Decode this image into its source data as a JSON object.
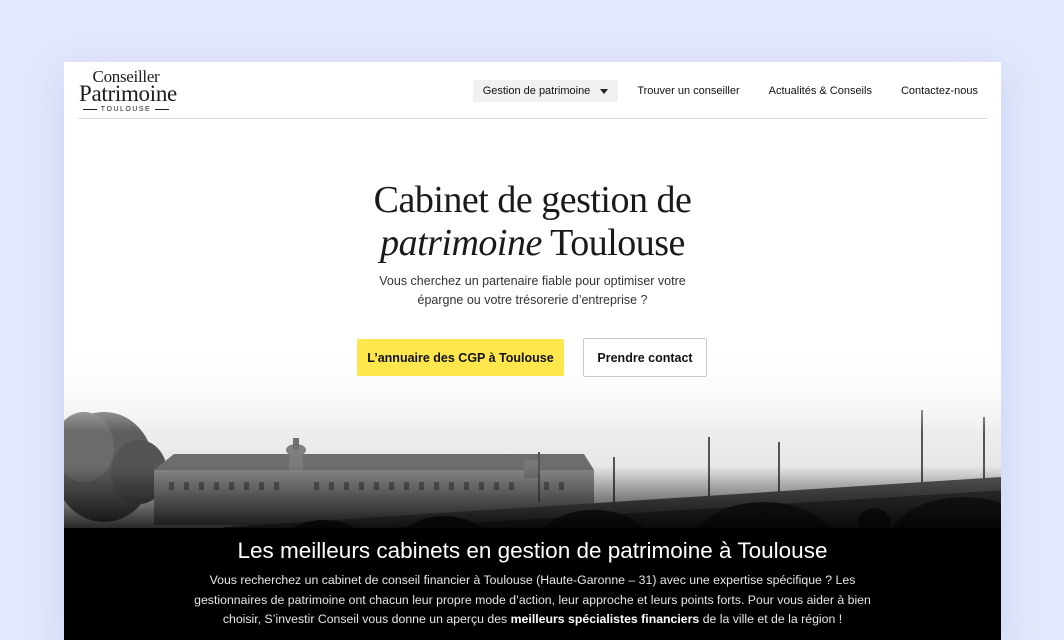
{
  "logo": {
    "line1": "Conseiller",
    "line2": "Patrimoine",
    "line3": "TOULOUSE"
  },
  "nav": {
    "items": [
      {
        "label": "Gestion de patrimoine",
        "has_dropdown": true
      },
      {
        "label": "Trouver un conseiller"
      },
      {
        "label": "Actualités & Conseils"
      },
      {
        "label": "Contactez-nous"
      }
    ]
  },
  "hero": {
    "title_line1": "Cabinet de gestion de",
    "title_italic": "patrimoine",
    "title_rest": " Toulouse",
    "subtitle": "Vous cherchez un partenaire fiable pour optimiser votre épargne ou votre trésorerie d’entreprise ?",
    "primary_button": "L’annuaire des CGP à Toulouse",
    "secondary_button": "Prendre contact"
  },
  "section": {
    "title": "Les meilleurs cabinets en gestion de patrimoine à Toulouse",
    "text_before": "Vous recherchez un cabinet de conseil financier à Toulouse (Haute-Garonne – 31) avec une expertise spécifique ? Les gestionnaires de patrimoine ont chacun leur propre mode d’action, leur approche et leurs points forts. Pour vous aider à bien choisir, S’investir Conseil vous donne un aperçu des ",
    "text_bold": "meilleurs spécialistes financiers",
    "text_after": " de la ville et de la région !"
  },
  "colors": {
    "page_bg": "#e3e8fc",
    "accent_yellow": "#fde74c",
    "dark_band": "#000000"
  }
}
